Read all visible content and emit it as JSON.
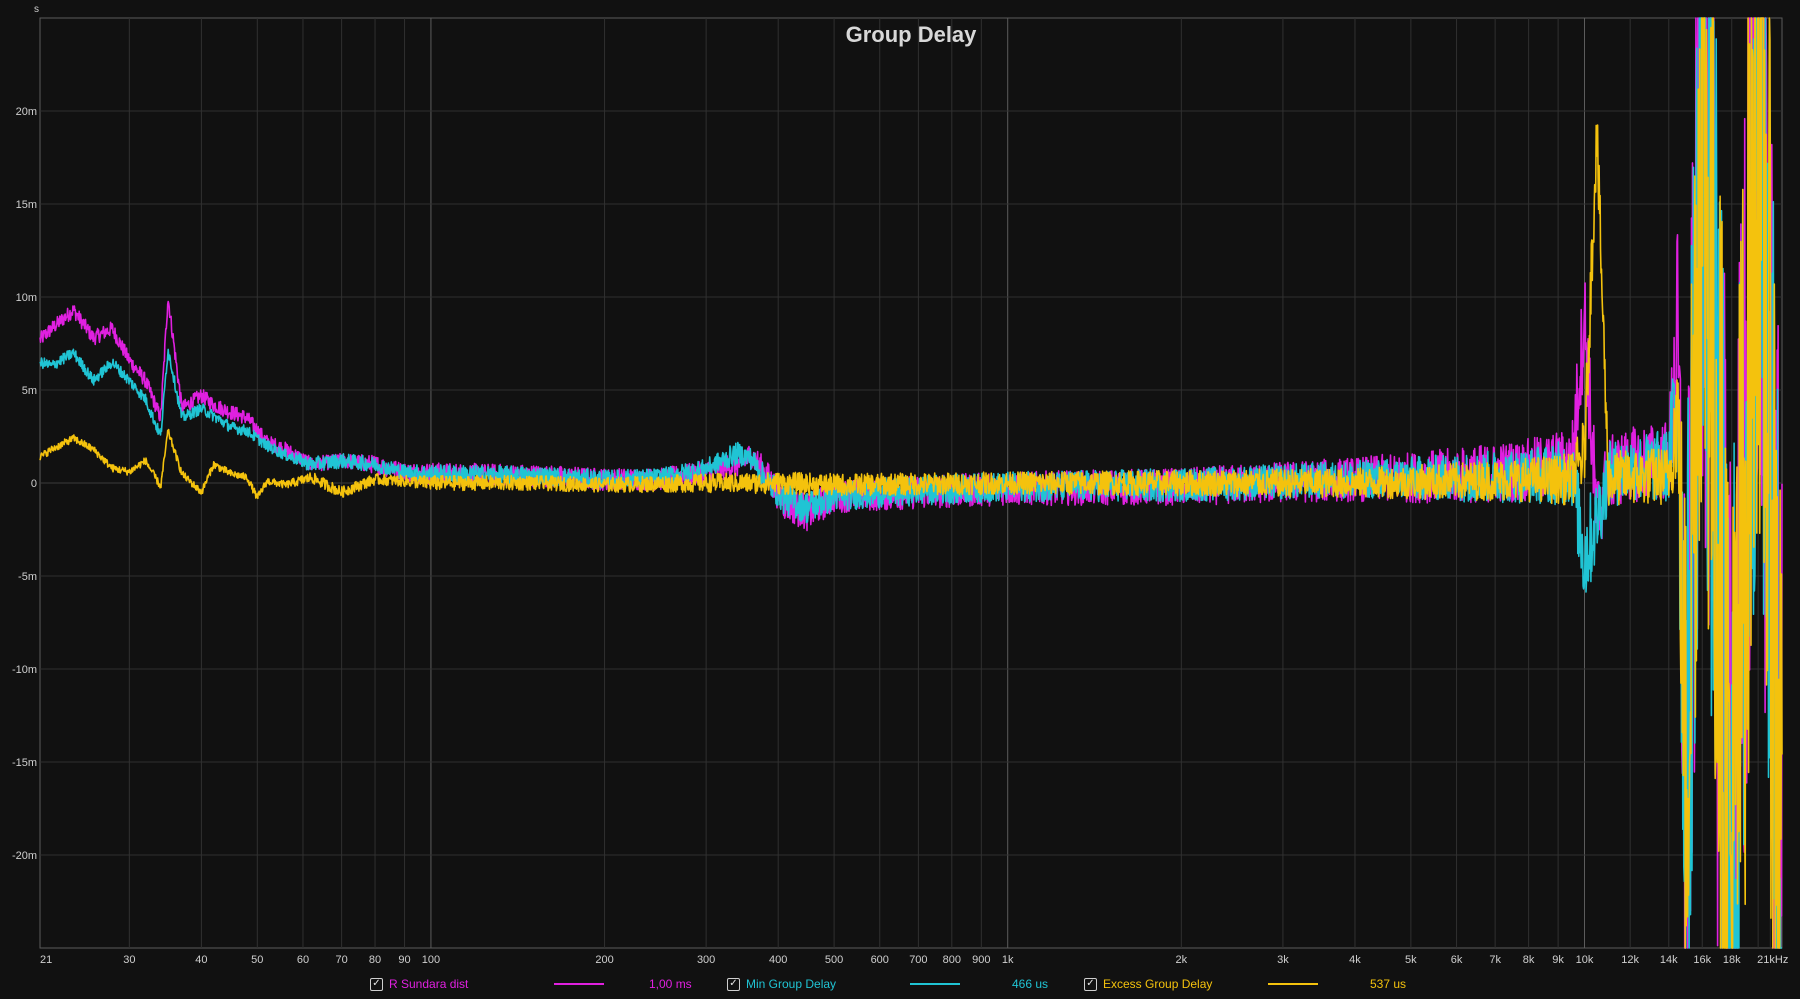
{
  "chart_data": {
    "type": "line",
    "title": "Group Delay",
    "ylabel": "s",
    "xscale": "log",
    "xlim": [
      21,
      22000
    ],
    "ylim": [
      -0.025,
      0.025
    ],
    "x_ticks": [
      {
        "v": 21,
        "label": "21"
      },
      {
        "v": 30,
        "label": "30"
      },
      {
        "v": 40,
        "label": "40"
      },
      {
        "v": 50,
        "label": "50"
      },
      {
        "v": 60,
        "label": "60"
      },
      {
        "v": 70,
        "label": "70"
      },
      {
        "v": 80,
        "label": "80"
      },
      {
        "v": 90,
        "label": "90"
      },
      {
        "v": 100,
        "label": "100"
      },
      {
        "v": 200,
        "label": "200"
      },
      {
        "v": 300,
        "label": "300"
      },
      {
        "v": 400,
        "label": "400"
      },
      {
        "v": 500,
        "label": "500"
      },
      {
        "v": 600,
        "label": "600"
      },
      {
        "v": 700,
        "label": "700"
      },
      {
        "v": 800,
        "label": "800"
      },
      {
        "v": 900,
        "label": "900"
      },
      {
        "v": 1000,
        "label": "1k"
      },
      {
        "v": 2000,
        "label": "2k"
      },
      {
        "v": 3000,
        "label": "3k"
      },
      {
        "v": 4000,
        "label": "4k"
      },
      {
        "v": 5000,
        "label": "5k"
      },
      {
        "v": 6000,
        "label": "6k"
      },
      {
        "v": 7000,
        "label": "7k"
      },
      {
        "v": 8000,
        "label": "8k"
      },
      {
        "v": 9000,
        "label": "9k"
      },
      {
        "v": 10000,
        "label": "10k"
      },
      {
        "v": 12000,
        "label": "12k"
      },
      {
        "v": 14000,
        "label": "14k"
      },
      {
        "v": 16000,
        "label": "16k"
      },
      {
        "v": 18000,
        "label": "18k"
      },
      {
        "v": 21000,
        "label": "21kHz"
      }
    ],
    "y_ticks": [
      {
        "v": 0.02,
        "label": "20m"
      },
      {
        "v": 0.015,
        "label": "15m"
      },
      {
        "v": 0.01,
        "label": "10m"
      },
      {
        "v": 0.005,
        "label": "5m"
      },
      {
        "v": 0,
        "label": "0"
      },
      {
        "v": -0.005,
        "label": "-5m"
      },
      {
        "v": -0.01,
        "label": "-10m"
      },
      {
        "v": -0.015,
        "label": "-15m"
      },
      {
        "v": -0.02,
        "label": "-20m"
      }
    ],
    "grid": true,
    "legend_position": "bottom",
    "series": [
      {
        "name": "R Sundara dist",
        "color": "#e020e0",
        "value_label": "1,00 ms",
        "checked": true,
        "x": [
          21,
          22,
          24,
          26,
          28,
          30,
          32,
          34,
          35,
          37,
          40,
          42,
          45,
          48,
          52,
          56,
          62,
          70,
          80,
          90,
          100,
          150,
          200,
          250,
          300,
          340,
          360,
          380,
          410,
          450,
          500,
          700,
          1000,
          2000,
          4000,
          6000,
          8000,
          9500,
          10000,
          10500,
          11000,
          12000,
          14000,
          14500,
          15000,
          16000,
          18000,
          20000,
          22000
        ],
        "y": [
          0.0077,
          0.0083,
          0.0093,
          0.0078,
          0.0083,
          0.0066,
          0.0055,
          0.0035,
          0.01,
          0.004,
          0.0047,
          0.0042,
          0.0038,
          0.0035,
          0.0022,
          0.0018,
          0.001,
          0.0012,
          0.001,
          0.0006,
          0.0005,
          0.0004,
          0.0002,
          0.0002,
          0.0006,
          0.001,
          0.0015,
          0.0005,
          -0.001,
          -0.0016,
          -0.0007,
          -0.0005,
          -0.0003,
          -0.0002,
          0.0002,
          0.0004,
          0.0007,
          0.001,
          0.009,
          -0.002,
          0.0005,
          0.001,
          0.0012,
          0.008,
          -0.02,
          0.025,
          -0.025,
          0.024,
          -0.023
        ],
        "noise": [
          0.0004,
          0.0004,
          0.0004,
          0.0004,
          0.0004,
          0.0004,
          0.0004,
          0.0004,
          0.0004,
          0.0004,
          0.0004,
          0.0004,
          0.0004,
          0.0004,
          0.0004,
          0.0004,
          0.0004,
          0.0004,
          0.0005,
          0.0005,
          0.0006,
          0.0006,
          0.0006,
          0.0006,
          0.0006,
          0.0007,
          0.0007,
          0.0008,
          0.001,
          0.001,
          0.0009,
          0.0009,
          0.0009,
          0.001,
          0.0012,
          0.0015,
          0.0017,
          0.002,
          0.003,
          0.0025,
          0.002,
          0.002,
          0.0022,
          0.006,
          0.018,
          0.024,
          0.024,
          0.024,
          0.024
        ]
      },
      {
        "name": "Min Group Delay",
        "color": "#20c4d4",
        "value_label": "466 us",
        "checked": true,
        "x": [
          21,
          22,
          24,
          26,
          28,
          30,
          32,
          34,
          35,
          37,
          40,
          42,
          45,
          48,
          52,
          56,
          62,
          70,
          80,
          90,
          100,
          150,
          200,
          250,
          300,
          340,
          360,
          380,
          410,
          450,
          500,
          700,
          1000,
          2000,
          4000,
          6000,
          8000,
          9500,
          10000,
          10500,
          11000,
          12000,
          14000,
          14500,
          15000,
          16000,
          18000,
          20000,
          22000
        ],
        "y": [
          0.0065,
          0.0063,
          0.007,
          0.0055,
          0.0065,
          0.0055,
          0.0045,
          0.0025,
          0.0072,
          0.0035,
          0.004,
          0.0036,
          0.003,
          0.0028,
          0.002,
          0.0015,
          0.001,
          0.0012,
          0.001,
          0.0006,
          0.0005,
          0.0004,
          0.0002,
          0.0003,
          0.0008,
          0.0016,
          0.0013,
          0.0002,
          -0.0008,
          -0.0013,
          -0.0007,
          -0.0004,
          -0.0002,
          -0.0001,
          0.0002,
          0.0003,
          0.0004,
          0.0006,
          -0.004,
          -0.002,
          0.0004,
          0.0008,
          0.0009,
          0.006,
          -0.018,
          0.024,
          -0.024,
          0.023,
          -0.022
        ],
        "noise": [
          0.0003,
          0.0003,
          0.0003,
          0.0003,
          0.0003,
          0.0003,
          0.0003,
          0.0003,
          0.0003,
          0.0003,
          0.0003,
          0.0003,
          0.0003,
          0.0003,
          0.0003,
          0.0003,
          0.0004,
          0.0004,
          0.0004,
          0.0004,
          0.0005,
          0.0005,
          0.0005,
          0.0005,
          0.0005,
          0.0006,
          0.0006,
          0.0007,
          0.0009,
          0.0009,
          0.0008,
          0.0008,
          0.0008,
          0.0009,
          0.001,
          0.0013,
          0.0015,
          0.0018,
          0.003,
          0.0022,
          0.0018,
          0.0018,
          0.002,
          0.005,
          0.017,
          0.023,
          0.023,
          0.023,
          0.023
        ]
      },
      {
        "name": "Excess Group Delay",
        "color": "#f4c20d",
        "value_label": "537 us",
        "checked": true,
        "x": [
          21,
          22,
          24,
          26,
          28,
          30,
          32,
          34,
          35,
          37,
          40,
          42,
          45,
          48,
          50,
          52,
          56,
          62,
          70,
          80,
          90,
          100,
          150,
          200,
          300,
          400,
          500,
          1000,
          2000,
          4000,
          6000,
          8000,
          9500,
          10000,
          10500,
          11000,
          12000,
          14000,
          14500,
          15000,
          16000,
          18000,
          20000,
          22000
        ],
        "y": [
          0.0014,
          0.0018,
          0.0024,
          0.0018,
          0.0008,
          0.0006,
          0.0012,
          -0.0002,
          0.0028,
          0.0005,
          -0.0005,
          0.001,
          0.0005,
          0.0003,
          -0.0008,
          0.0001,
          -0.0001,
          0.0003,
          -0.0005,
          0.0002,
          0.0001,
          0.0,
          0.0,
          -0.0001,
          0.0,
          0.0,
          -0.0001,
          0.0,
          0.0,
          0.0,
          0.0001,
          0.0002,
          0.0002,
          0.0016,
          0.019,
          0.0002,
          0.0003,
          0.0004,
          0.004,
          -0.016,
          0.023,
          -0.023,
          0.022,
          -0.02
        ],
        "noise": [
          0.0002,
          0.0002,
          0.0002,
          0.0002,
          0.0002,
          0.0002,
          0.0002,
          0.0002,
          0.0002,
          0.0002,
          0.0002,
          0.0002,
          0.0002,
          0.0002,
          0.0002,
          0.0002,
          0.0002,
          0.0003,
          0.0003,
          0.0003,
          0.0003,
          0.0004,
          0.0004,
          0.0004,
          0.0005,
          0.0006,
          0.0006,
          0.0006,
          0.0007,
          0.0008,
          0.001,
          0.0012,
          0.0014,
          0.002,
          0.002,
          0.0015,
          0.0015,
          0.0016,
          0.004,
          0.016,
          0.023,
          0.023,
          0.023,
          0.023
        ]
      }
    ]
  }
}
